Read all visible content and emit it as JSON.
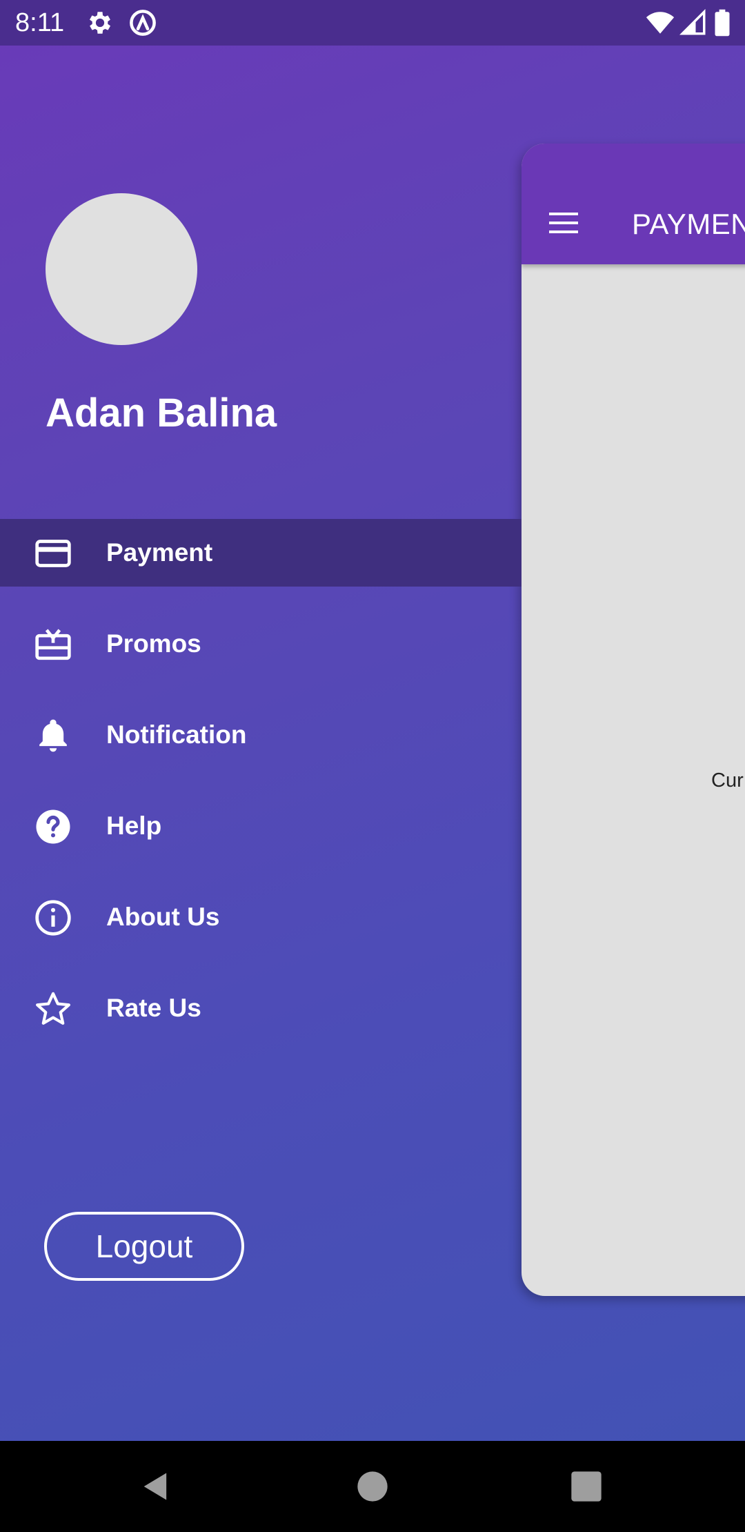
{
  "status_bar": {
    "time": "8:11",
    "icons": [
      "settings-icon",
      "at-sign-icon",
      "wifi-icon",
      "cellular-signal-icon",
      "battery-icon"
    ]
  },
  "drawer": {
    "user_name": "Adan Balina",
    "items": [
      {
        "label": "Payment",
        "icon": "credit-card-icon",
        "active": true
      },
      {
        "label": "Promos",
        "icon": "gift-card-icon",
        "active": false
      },
      {
        "label": "Notification",
        "icon": "bell-icon",
        "active": false
      },
      {
        "label": "Help",
        "icon": "help-circle-icon",
        "active": false
      },
      {
        "label": "About Us",
        "icon": "info-icon",
        "active": false
      },
      {
        "label": "Rate Us",
        "icon": "star-icon",
        "active": false
      }
    ],
    "logout_label": "Logout"
  },
  "main": {
    "toolbar_title": "PAYMEN",
    "body_text": "Cur"
  },
  "nav_bar": {
    "icons": [
      "back-icon",
      "home-icon",
      "recents-icon"
    ]
  },
  "colors": {
    "drawer_gradient_start": "#6a3ab8",
    "drawer_gradient_end": "#4153b4",
    "active_item_bg": "#3f2f7f",
    "toolbar": "#6a38b6",
    "status_bar": "#4a2d8e"
  }
}
